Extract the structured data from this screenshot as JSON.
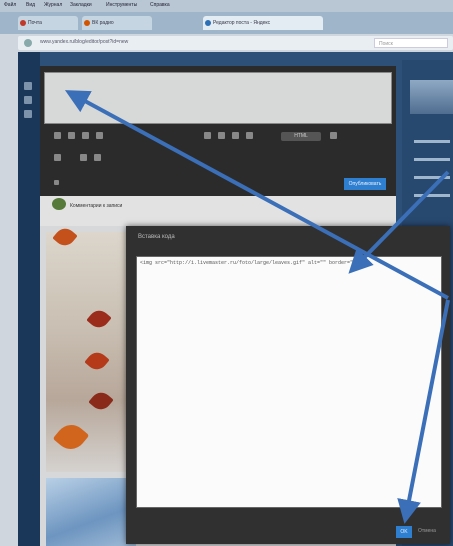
{
  "browser": {
    "menu_items": [
      "Файл",
      "Вид",
      "Журнал",
      "Закладки",
      "Инструменты",
      "Справка"
    ],
    "tabs": [
      {
        "label": "Почта",
        "color": "#c0392b"
      },
      {
        "label": "ВК радио",
        "color": "#d35400"
      },
      {
        "label": "Редактор поста - Яндекс",
        "color": "#2c6fb5"
      }
    ],
    "address": "www.yandex.ru/blog/editor/post?id=new",
    "search_placeholder": "Поиск"
  },
  "editor": {
    "toolbar_pill_label": "HTML",
    "publish_label": "Опубликовать",
    "comments_label": "Комментарии к записи"
  },
  "dialog": {
    "title": "Вставка кода",
    "code": "<img src=\"http://i.livemaster.ru/foto/large/leaves.gif\" alt=\"\" border=\"0\" />",
    "ok_label": "OK",
    "cancel_label": "Отмена"
  },
  "colors": {
    "accent": "#2f7fd0",
    "arrow": "#3b6fb8"
  }
}
